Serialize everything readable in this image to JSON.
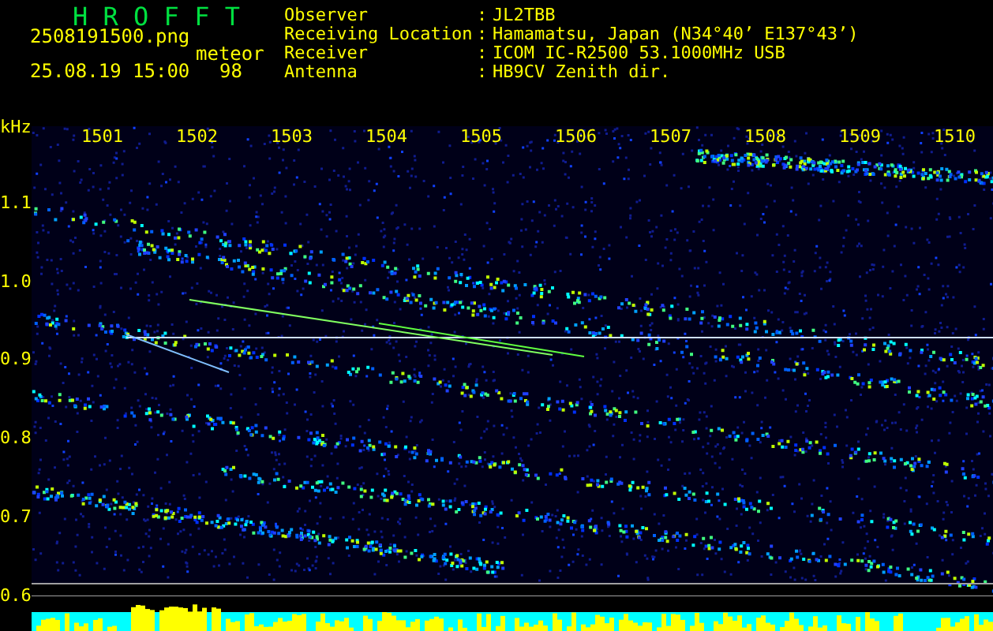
{
  "app_title": "H R O F F T",
  "file_name": "2508191500.png",
  "timestamp": "25.08.19 15:00",
  "count_label": "meteor",
  "count": "98",
  "station": [
    {
      "label": "Observer",
      "separator": ":",
      "value": "JL2TBB"
    },
    {
      "label": "Receiving Location",
      "separator": ":",
      "value": "Hamamatsu, Japan (N34°40’ E137°43’)"
    },
    {
      "label": "Receiver",
      "separator": ":",
      "value": "ICOM IC-R2500 53.1000MHz USB"
    },
    {
      "label": "Antenna",
      "separator": ":",
      "value": "HB9CV Zenith dir."
    }
  ],
  "spectrogram": {
    "y_unit": "kHz",
    "x_ticks": [
      "1501",
      "1502",
      "1503",
      "1504",
      "1505",
      "1506",
      "1507",
      "1508",
      "1509",
      "1510"
    ],
    "y_ticks": [
      "1.1",
      "1.0",
      "0.9",
      "0.8",
      "0.7",
      "0.6"
    ]
  }
}
